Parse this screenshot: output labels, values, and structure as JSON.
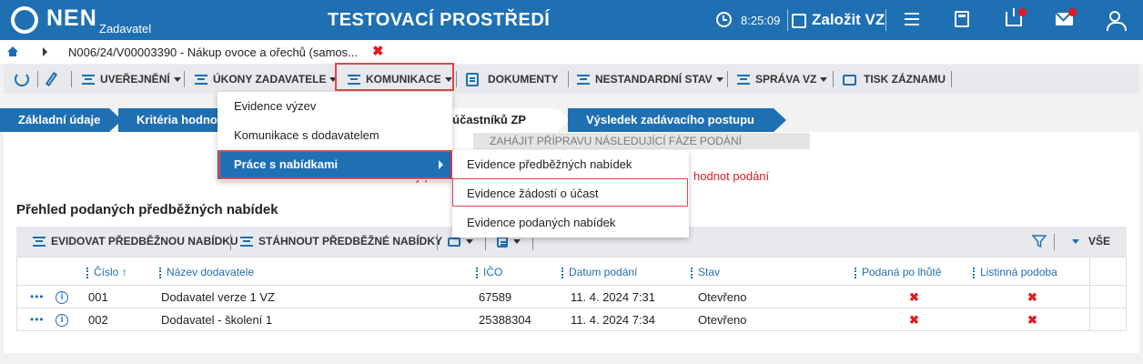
{
  "header": {
    "logo": "NEN",
    "logo_sub": "Zadavatel",
    "env_title": "TESTOVACÍ PROSTŘEDÍ",
    "clock": "8:25:09",
    "create_label": "Založit VZ",
    "icons": [
      "clock-icon",
      "pen-icon",
      "menu-icon",
      "calculator-icon",
      "inbox-icon",
      "mail-icon",
      "user-icon"
    ],
    "notification_color": "#e11b22"
  },
  "breadcrumb": {
    "text": "N006/24/V00003390 - Nákup ovoce a ořechů (samos...",
    "close": "✖"
  },
  "toolbar": {
    "items": [
      "UVEŘEJNĚNÍ",
      "ÚKONY ZADAVATELE",
      "KOMUNIKACE",
      "DOKUMENTY",
      "NESTANDARDNÍ STAV",
      "SPRÁVA VZ",
      "TISK ZÁZNAMU"
    ]
  },
  "tabs": [
    "Základní údaje",
    "Kritéria hodno",
    "ní účastníků ZP",
    "Výsledek zadávacího postupu"
  ],
  "content": {
    "grey_bar": "ZAHÁJIT PŘÍPRAVU NÁSLEDUJÍCÍ FÁZE PODÁNÍ",
    "warn_left": "Sy pro",
    "warn_right": "hodnot podání",
    "section_title": "Přehled podaných předběžných nabídek",
    "grid_toolbar": {
      "add_label": "EVIDOVAT PŘEDBĚŽNOU NABÍDKU",
      "download_label": "STÁHNOUT PŘEDBĚŽNÉ NABÍDKY",
      "all_label": "VŠE"
    }
  },
  "table": {
    "columns": [
      "Číslo",
      "Název dodavatele",
      "IČO",
      "Datum podání",
      "Stav",
      "Podaná po lhůtě",
      "Listinná podoba"
    ],
    "sort_indicator": "↑",
    "rows": [
      {
        "cislo": "001",
        "nazev": "Dodavatel verze 1 VZ",
        "ico": "67589",
        "datum": "11. 4. 2024 7:31",
        "stav": "Otevřeno",
        "po_lhute": "✖",
        "listinna": "✖"
      },
      {
        "cislo": "002",
        "nazev": "Dodavatel - školení 1",
        "ico": "25388304",
        "datum": "11. 4. 2024 7:34",
        "stav": "Otevřeno",
        "po_lhute": "✖",
        "listinna": "✖"
      }
    ]
  },
  "menu_komunikace": {
    "items": [
      "Evidence výzev",
      "Komunikace s dodavatelem",
      "Práce s nabídkami"
    ],
    "selected_index": 2
  },
  "submenu_nabidky": {
    "items": [
      "Evidence předběžných nabídek",
      "Evidence žádostí o účast",
      "Evidence podaných nabídek"
    ],
    "highlighted_index": 1
  },
  "colors": {
    "brand": "#1f6fb3",
    "highlight": "#e0454c",
    "error": "#e11b22"
  }
}
